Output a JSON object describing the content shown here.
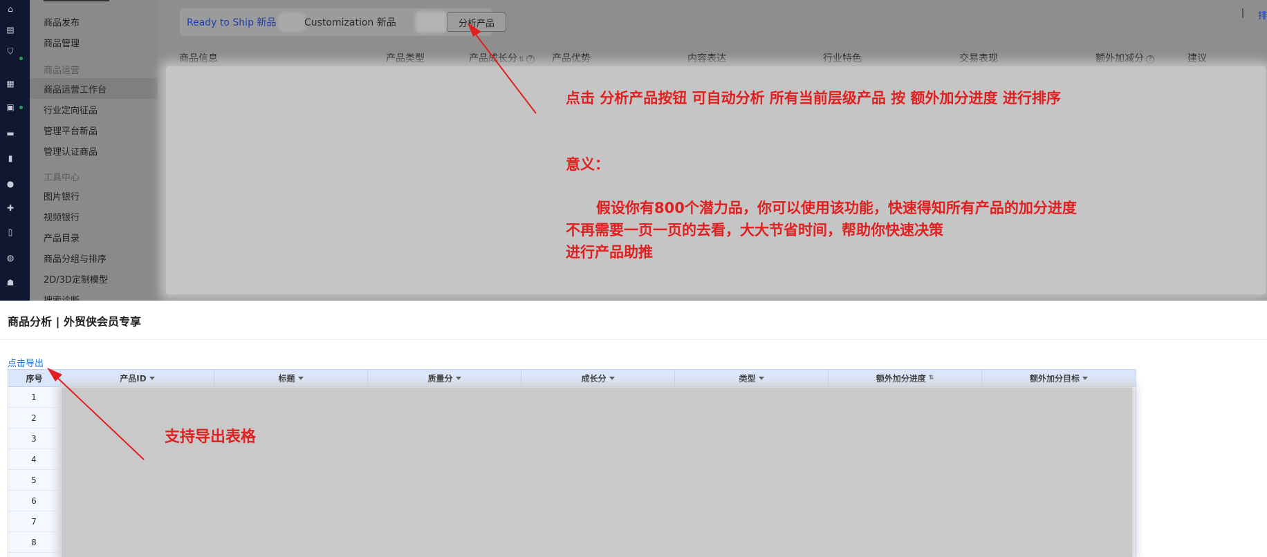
{
  "sidebar": {
    "items": [
      {
        "label": "商品发布"
      },
      {
        "label": "商品管理"
      },
      {
        "group": "商品运营"
      },
      {
        "label": "商品运营工作台",
        "active": true
      },
      {
        "label": "行业定向征品"
      },
      {
        "label": "管理平台新品"
      },
      {
        "label": "管理认证商品"
      },
      {
        "group": "工具中心"
      },
      {
        "label": "图片银行"
      },
      {
        "label": "视频银行"
      },
      {
        "label": "产品目录"
      },
      {
        "label": "商品分组与排序"
      },
      {
        "label": "2D/3D定制模型"
      },
      {
        "label": "搜索诊断"
      }
    ]
  },
  "tabs": {
    "ready_to_ship": "Ready to Ship 新品",
    "customization": "Customization 新品",
    "analyze_button": "分析产品"
  },
  "table_top": {
    "headers": [
      "商品信息",
      "产品类型",
      "产品成长分",
      "产品优势",
      "内容表达",
      "行业特色",
      "交易表现",
      "额外加减分",
      "建议"
    ]
  },
  "top_right": {
    "link": "排"
  },
  "annotations": {
    "analyze_note": "点击 分析产品按钮  可自动分析 所有当前层级产品 按 额外加分进度 进行排序",
    "meaning_title": "意义：",
    "meaning_line1": "假设你有800个潜力品，你可以使用该功能，快速得知所有产品的加分进度",
    "meaning_line2": "不再需要一页一页的去看，大大节省时间，帮助你快速决策",
    "meaning_line3": "进行产品助推",
    "export_note": "支持导出表格"
  },
  "panel": {
    "title": "商品分析 | 外贸侠会员专享",
    "export_link": "点击导出",
    "columns": [
      "序号",
      "产品ID",
      "标题",
      "质量分",
      "成长分",
      "类型",
      "额外加分进度",
      "额外加分目标"
    ],
    "row_numbers": [
      "1",
      "2",
      "3",
      "4",
      "5",
      "6",
      "7",
      "8"
    ]
  },
  "colors": {
    "annotation_red": "#e02020",
    "link_blue": "#1f6fd6",
    "header_blue": "#dbe6fa",
    "rail_navy": "#101731"
  },
  "icons": [
    "home-icon",
    "store-icon",
    "shield-icon",
    "apps-icon",
    "calendar-icon",
    "chat-icon",
    "bar-chart-icon",
    "users-icon",
    "share-icon",
    "clipboard-icon",
    "globe-icon",
    "robot-icon"
  ]
}
